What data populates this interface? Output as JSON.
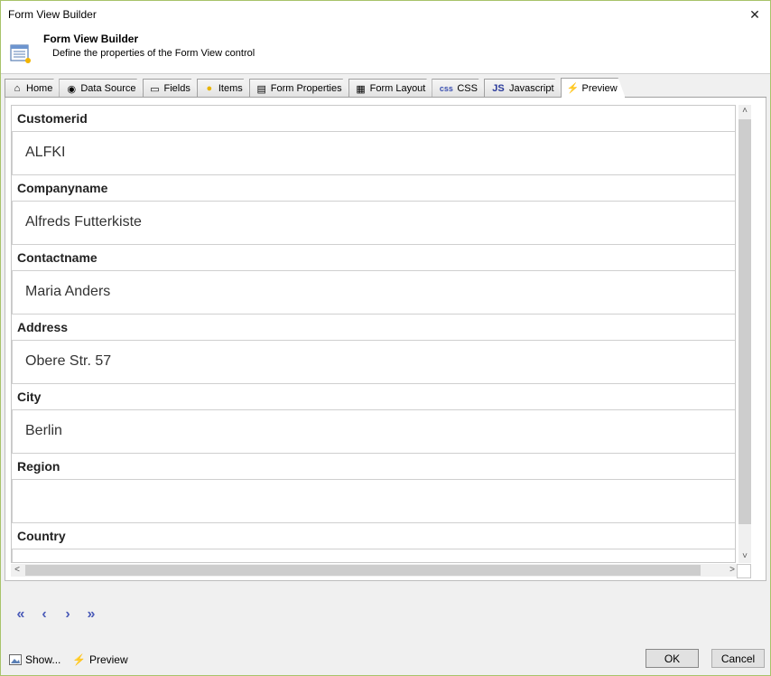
{
  "window": {
    "title": "Form View Builder",
    "close_glyph": "✕"
  },
  "header": {
    "icon": "form-builder-icon",
    "title": "Form View Builder",
    "subtitle": "Define the properties of the Form View control"
  },
  "tabs": [
    {
      "label": "Home",
      "icon": "home-icon",
      "glyph": "⌂"
    },
    {
      "label": "Data Source",
      "icon": "database-icon",
      "glyph": "◉"
    },
    {
      "label": "Fields",
      "icon": "field-icon",
      "glyph": "▭"
    },
    {
      "label": "Items",
      "icon": "item-icon",
      "glyph": "●"
    },
    {
      "label": "Form Properties",
      "icon": "form-properties-icon",
      "glyph": "▤"
    },
    {
      "label": "Form Layout",
      "icon": "layout-icon",
      "glyph": "▦"
    },
    {
      "label": "CSS",
      "icon": "css-icon",
      "glyph": "css"
    },
    {
      "label": "Javascript",
      "icon": "js-icon",
      "glyph": "JS"
    },
    {
      "label": "Preview",
      "icon": "lightning-icon",
      "glyph": "⚡",
      "active": true
    }
  ],
  "form": {
    "fields": [
      {
        "label": "Customerid",
        "value": "ALFKI"
      },
      {
        "label": "Companyname",
        "value": "Alfreds Futterkiste"
      },
      {
        "label": "Contactname",
        "value": "Maria Anders"
      },
      {
        "label": "Address",
        "value": "Obere Str. 57"
      },
      {
        "label": "City",
        "value": "Berlin"
      },
      {
        "label": "Region",
        "value": ""
      },
      {
        "label": "Country",
        "value": ""
      }
    ]
  },
  "scrollbars": {
    "up": "˄",
    "down": "˅",
    "left": "<",
    "right": ">"
  },
  "pager": {
    "first": "«",
    "prev": "‹",
    "next": "›",
    "last": "»"
  },
  "footer": {
    "show_label": "Show...",
    "preview_label": "Preview",
    "ok_label": "OK",
    "cancel_label": "Cancel"
  },
  "colors": {
    "accent": "#4b5bb8",
    "window_border": "#a8c36a",
    "bolt": "#e8a800"
  }
}
